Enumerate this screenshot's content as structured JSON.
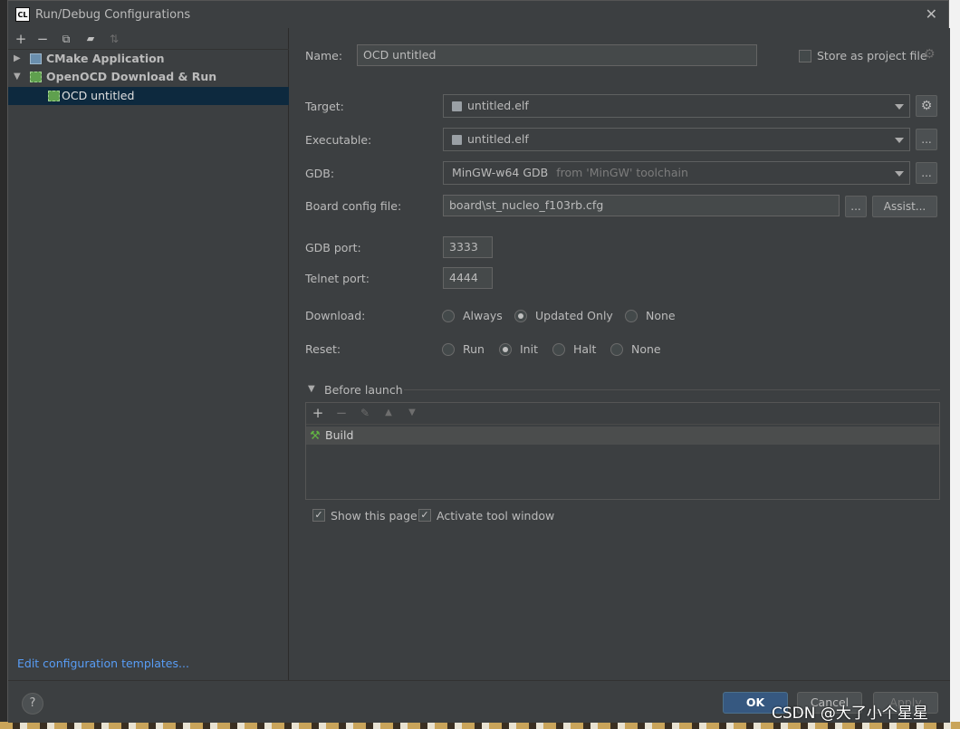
{
  "window": {
    "title": "Run/Debug Configurations",
    "app_icon": "CL"
  },
  "left": {
    "toolbar": [
      "+",
      "−",
      "⧉",
      "▸",
      "⇅"
    ],
    "tree": [
      {
        "label": "CMake Application",
        "expanded": false
      },
      {
        "label": "OpenOCD Download & Run",
        "expanded": true
      },
      {
        "label": "OCD untitled",
        "selected": true
      }
    ],
    "edit_templates": "Edit configuration templates..."
  },
  "form": {
    "name_label": "Name:",
    "name_value": "OCD untitled",
    "store_label": "Store as project file",
    "target_label": "Target:",
    "target_value": "untitled.elf",
    "executable_label": "Executable:",
    "executable_value": "untitled.elf",
    "gdb_label": "GDB:",
    "gdb_value": "MinGW-w64 GDB",
    "gdb_hint": "from 'MinGW' toolchain",
    "board_label": "Board config file:",
    "board_value": "board\\st_nucleo_f103rb.cfg",
    "assist_label": "Assist...",
    "ellipsis_label": "...",
    "gdb_port_label": "GDB port:",
    "gdb_port_value": "3333",
    "telnet_port_label": "Telnet port:",
    "telnet_port_value": "4444",
    "download_label": "Download:",
    "download_options": [
      "Always",
      "Updated Only",
      "None"
    ],
    "download_selected": "Updated Only",
    "reset_label": "Reset:",
    "reset_options": [
      "Run",
      "Init",
      "Halt",
      "None"
    ],
    "reset_selected": "Init"
  },
  "before_launch": {
    "title": "Before launch",
    "tasks": [
      "Build"
    ]
  },
  "options": {
    "show_page": "Show this page",
    "activate_tool": "Activate tool window"
  },
  "footer": {
    "help": "?",
    "ok": "OK",
    "cancel": "Cancel",
    "apply": "Apply"
  },
  "watermark": "CSDN @大了小个星星"
}
